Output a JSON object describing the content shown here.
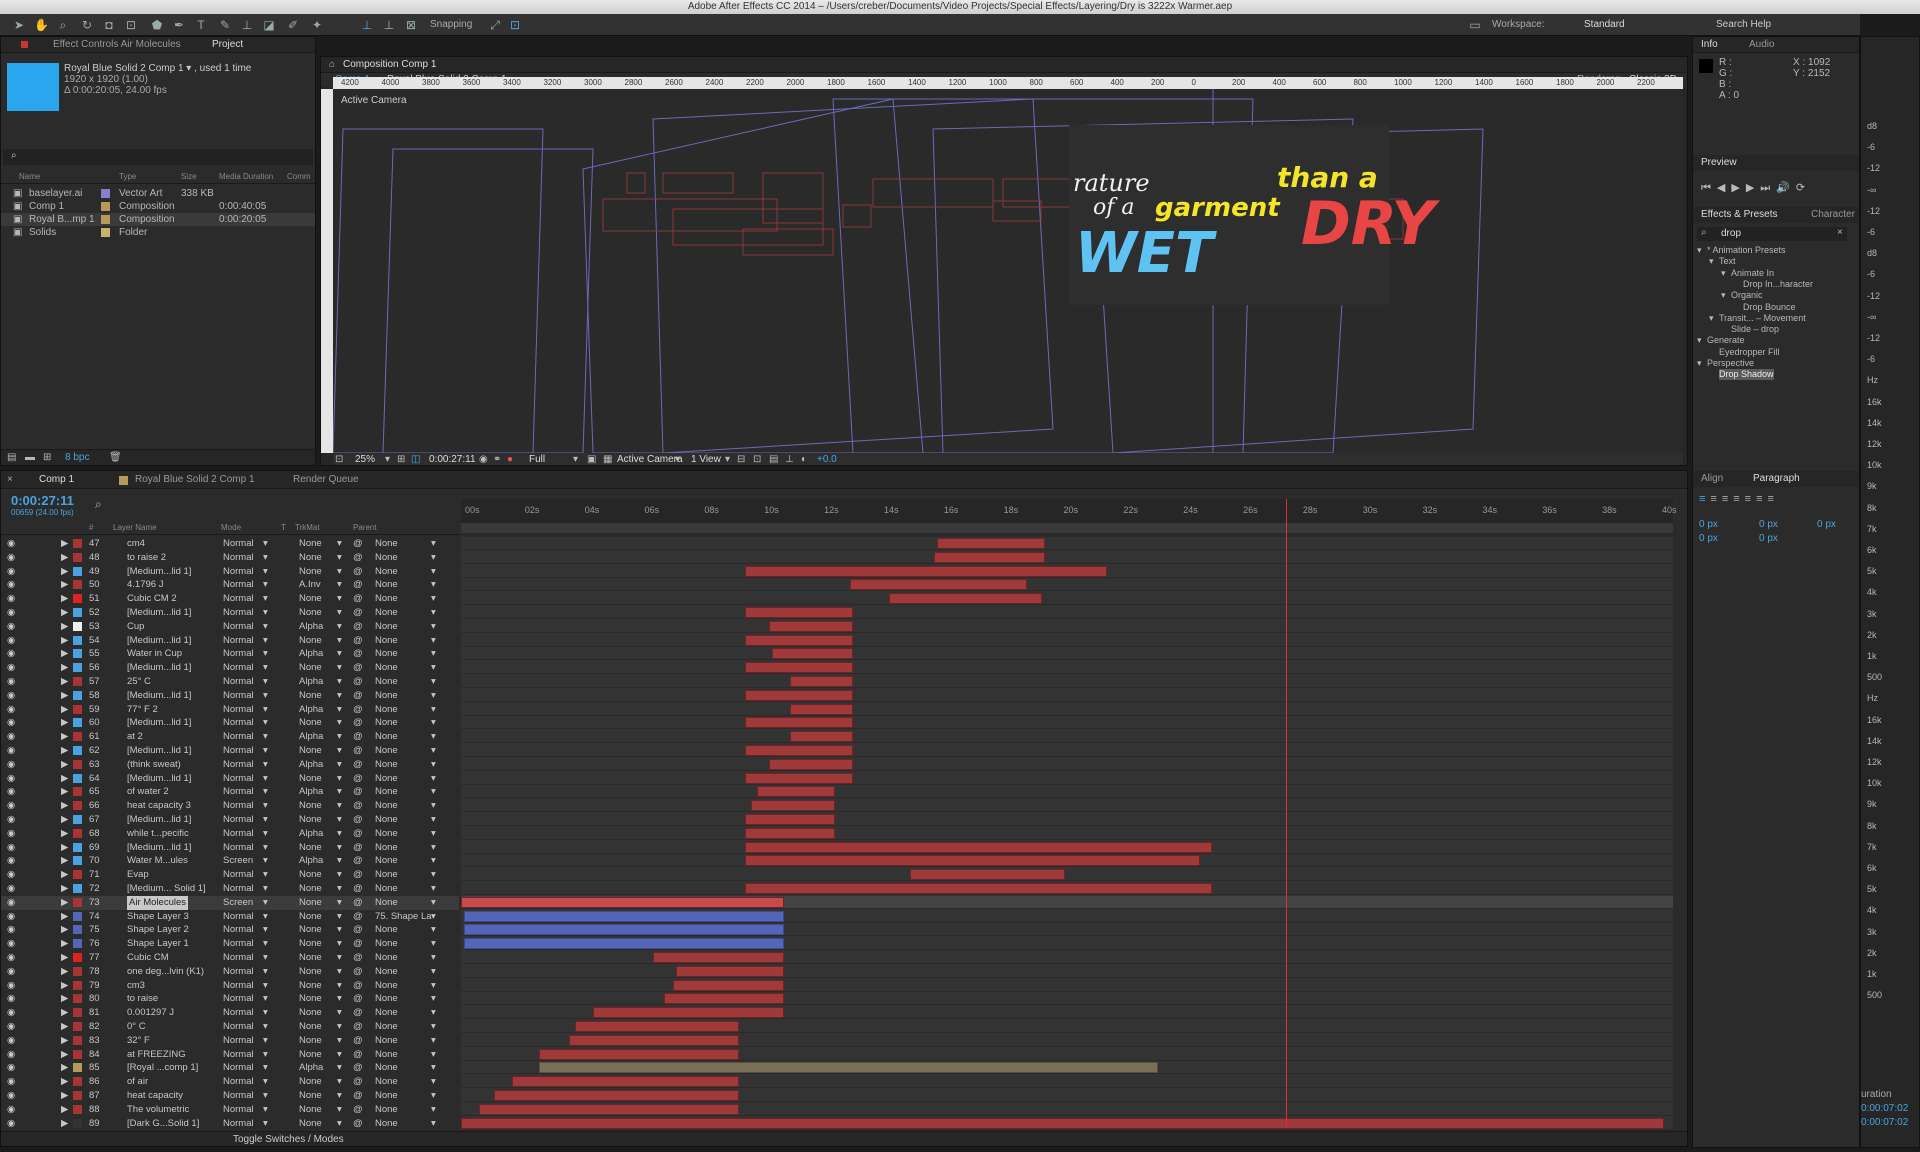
{
  "app": {
    "title": "Adobe After Effects CC 2014 – /Users/creber/Documents/Video Projects/Special Effects/Layering/Dry is 3222x Warmer.aep",
    "snapping": "Snapping",
    "workspace_label": "Workspace:",
    "workspace_value": "Standard",
    "search_help": "Search Help"
  },
  "project": {
    "tabs": [
      "Effect Controls Air Molecules",
      "Project"
    ],
    "selected_name": "Royal Blue Solid 2 Comp 1 ▾ , used 1 time",
    "dims": "1920 x 1920 (1.00)",
    "duration": "Δ 0:00:20:05, 24.00 fps",
    "columns": [
      "Name",
      "Type",
      "Size",
      "Media Duration",
      "Comm"
    ],
    "items": [
      {
        "name": "baselayer.ai",
        "type": "Vector Art",
        "size": "338 KB",
        "dur": "",
        "color": "#8b7fc7"
      },
      {
        "name": "Comp 1",
        "type": "Composition",
        "size": "",
        "dur": "0:00:40:05",
        "color": "#b59a5a"
      },
      {
        "name": "Royal B...mp 1",
        "type": "Composition",
        "size": "",
        "dur": "0:00:20:05",
        "color": "#b59a5a"
      },
      {
        "name": "Solids",
        "type": "Folder",
        "size": "",
        "dur": "",
        "color": "#c9b26b"
      }
    ],
    "bpc": "8 bpc"
  },
  "viewer": {
    "tab": "Composition Comp 1",
    "breadcrumb": [
      "Comp 1",
      "Royal Blue Solid 2 Comp 1"
    ],
    "renderer_label": "Renderer:",
    "renderer": "Classic 3D",
    "active_camera": "Active Camera",
    "ruler": [
      "4200",
      "4000",
      "3800",
      "3600",
      "3400",
      "3200",
      "3000",
      "2800",
      "2600",
      "2400",
      "2200",
      "2000",
      "1800",
      "1600",
      "1400",
      "1200",
      "1000",
      "800",
      "600",
      "400",
      "200",
      "0",
      "200",
      "400",
      "600",
      "800",
      "1000",
      "1200",
      "1400",
      "1600",
      "1800",
      "2000",
      "2200"
    ],
    "zoom": "25%",
    "timecode": "0:00:27:11",
    "resolution": "Full",
    "camera": "Active Camera",
    "views": "1 View",
    "exposure": "+0.0",
    "art": {
      "line1": "rature",
      "line2a": "of a",
      "line2b": "garment",
      "line3": "WET",
      "than": "than a",
      "dry": "DRY"
    }
  },
  "timeline": {
    "tabs": [
      "Comp 1",
      "Royal Blue Solid 2 Comp 1",
      "Render Queue"
    ],
    "timecode": "0:00:27:11",
    "frames": "00659 (24.00 fps)",
    "columns": [
      "#",
      "Layer Name",
      "Mode",
      "T",
      "TrkMat",
      "Parent"
    ],
    "ticks": [
      "00s",
      "02s",
      "04s",
      "06s",
      "08s",
      "10s",
      "12s",
      "14s",
      "16s",
      "18s",
      "20s",
      "22s",
      "24s",
      "26s",
      "28s",
      "30s",
      "32s",
      "34s",
      "36s",
      "38s",
      "40s"
    ],
    "toggle": "Toggle Switches / Modes",
    "layers": [
      {
        "n": "47",
        "name": "cm4",
        "mode": "Normal",
        "trk": "None",
        "parent": "None",
        "c": "#a33",
        "s": 15.9,
        "e": 19.5
      },
      {
        "n": "48",
        "name": "to raise 2",
        "mode": "Normal",
        "trk": "None",
        "parent": "None",
        "c": "#a33",
        "s": 15.8,
        "e": 19.5
      },
      {
        "n": "49",
        "name": "[Medium...lid 1]",
        "mode": "Normal",
        "trk": "None",
        "parent": "None",
        "c": "#4aa3e0",
        "s": 9.5,
        "e": 21.6
      },
      {
        "n": "50",
        "name": "4.1796 J",
        "mode": "Normal",
        "trk": "A.Inv",
        "parent": "None",
        "c": "#a33",
        "s": 13.0,
        "e": 18.9
      },
      {
        "n": "51",
        "name": "Cubic CM 2",
        "mode": "Normal",
        "trk": "None",
        "parent": "None",
        "c": "#d22",
        "s": 14.3,
        "e": 19.4
      },
      {
        "n": "52",
        "name": "[Medium...lid 1]",
        "mode": "Normal",
        "trk": "None",
        "parent": "None",
        "c": "#4aa3e0",
        "s": 9.5,
        "e": 13.1
      },
      {
        "n": "53",
        "name": "Cup",
        "mode": "Normal",
        "trk": "Alpha",
        "parent": "None",
        "c": "#eee",
        "s": 10.3,
        "e": 13.1
      },
      {
        "n": "54",
        "name": "[Medium...lid 1]",
        "mode": "Normal",
        "trk": "None",
        "parent": "None",
        "c": "#4aa3e0",
        "s": 9.5,
        "e": 13.1
      },
      {
        "n": "55",
        "name": "Water in Cup",
        "mode": "Normal",
        "trk": "Alpha",
        "parent": "None",
        "c": "#4aa3e0",
        "s": 10.4,
        "e": 13.1
      },
      {
        "n": "56",
        "name": "[Medium...lid 1]",
        "mode": "Normal",
        "trk": "None",
        "parent": "None",
        "c": "#4aa3e0",
        "s": 9.5,
        "e": 13.1
      },
      {
        "n": "57",
        "name": "25° C",
        "mode": "Normal",
        "trk": "Alpha",
        "parent": "None",
        "c": "#a33",
        "s": 11.0,
        "e": 13.1
      },
      {
        "n": "58",
        "name": "[Medium...lid 1]",
        "mode": "Normal",
        "trk": "None",
        "parent": "None",
        "c": "#4aa3e0",
        "s": 9.5,
        "e": 13.1
      },
      {
        "n": "59",
        "name": "77° F 2",
        "mode": "Normal",
        "trk": "Alpha",
        "parent": "None",
        "c": "#a33",
        "s": 11.0,
        "e": 13.1
      },
      {
        "n": "60",
        "name": "[Medium...lid 1]",
        "mode": "Normal",
        "trk": "None",
        "parent": "None",
        "c": "#4aa3e0",
        "s": 9.5,
        "e": 13.1
      },
      {
        "n": "61",
        "name": "at 2",
        "mode": "Normal",
        "trk": "Alpha",
        "parent": "None",
        "c": "#a33",
        "s": 11.0,
        "e": 13.1
      },
      {
        "n": "62",
        "name": "[Medium...lid 1]",
        "mode": "Normal",
        "trk": "None",
        "parent": "None",
        "c": "#4aa3e0",
        "s": 9.5,
        "e": 13.1
      },
      {
        "n": "63",
        "name": "(think sweat)",
        "mode": "Normal",
        "trk": "Alpha",
        "parent": "None",
        "c": "#a33",
        "s": 10.3,
        "e": 13.1
      },
      {
        "n": "64",
        "name": "[Medium...lid 1]",
        "mode": "Normal",
        "trk": "None",
        "parent": "None",
        "c": "#4aa3e0",
        "s": 9.5,
        "e": 13.1
      },
      {
        "n": "65",
        "name": "of water 2",
        "mode": "Normal",
        "trk": "Alpha",
        "parent": "None",
        "c": "#a33",
        "s": 9.9,
        "e": 12.5
      },
      {
        "n": "66",
        "name": "heat capacity 3",
        "mode": "Normal",
        "trk": "None",
        "parent": "None",
        "c": "#a33",
        "s": 9.7,
        "e": 12.5
      },
      {
        "n": "67",
        "name": "[Medium...lid 1]",
        "mode": "Normal",
        "trk": "None",
        "parent": "None",
        "c": "#4aa3e0",
        "s": 9.5,
        "e": 12.5
      },
      {
        "n": "68",
        "name": "while t...pecific",
        "mode": "Normal",
        "trk": "Alpha",
        "parent": "None",
        "c": "#a33",
        "s": 9.5,
        "e": 12.5
      },
      {
        "n": "69",
        "name": "[Medium...lid 1]",
        "mode": "Normal",
        "trk": "None",
        "parent": "None",
        "c": "#4aa3e0",
        "s": 9.5,
        "e": 25.1
      },
      {
        "n": "70",
        "name": "Water M...ules",
        "mode": "Screen",
        "trk": "Alpha",
        "parent": "None",
        "c": "#4aa3e0",
        "s": 9.5,
        "e": 24.7
      },
      {
        "n": "71",
        "name": "Evap",
        "mode": "Normal",
        "trk": "None",
        "parent": "None",
        "c": "#a33",
        "s": 15.0,
        "e": 20.2
      },
      {
        "n": "72",
        "name": "[Medium... Solid 1]",
        "mode": "Normal",
        "trk": "None",
        "parent": "None",
        "c": "#4aa3e0",
        "s": 9.5,
        "e": 25.1
      },
      {
        "n": "73",
        "name": "Air Molecules",
        "mode": "Screen",
        "trk": "None",
        "parent": "None",
        "c": "#a33",
        "s": 0,
        "e": 10.8,
        "sel": true
      },
      {
        "n": "74",
        "name": "Shape Layer 3",
        "mode": "Normal",
        "trk": "None",
        "parent": "75. Shape La",
        "c": "#5566b8",
        "s": 0.1,
        "e": 10.8,
        "blue": true
      },
      {
        "n": "75",
        "name": "Shape Layer 2",
        "mode": "Normal",
        "trk": "None",
        "parent": "None",
        "c": "#5566b8",
        "s": 0.1,
        "e": 10.8,
        "blue": true
      },
      {
        "n": "76",
        "name": "Shape Layer 1",
        "mode": "Normal",
        "trk": "None",
        "parent": "None",
        "c": "#5566b8",
        "s": 0.1,
        "e": 10.8,
        "blue": true
      },
      {
        "n": "77",
        "name": "Cubic CM",
        "mode": "Normal",
        "trk": "None",
        "parent": "None",
        "c": "#d22",
        "s": 6.4,
        "e": 10.8
      },
      {
        "n": "78",
        "name": "one deg...lvin (K1)",
        "mode": "Normal",
        "trk": "None",
        "parent": "None",
        "c": "#a33",
        "s": 7.2,
        "e": 10.8
      },
      {
        "n": "79",
        "name": "cm3",
        "mode": "Normal",
        "trk": "None",
        "parent": "None",
        "c": "#a33",
        "s": 7.1,
        "e": 10.8
      },
      {
        "n": "80",
        "name": "to raise",
        "mode": "Normal",
        "trk": "None",
        "parent": "None",
        "c": "#a33",
        "s": 6.8,
        "e": 10.8
      },
      {
        "n": "81",
        "name": "0.001297 J",
        "mode": "Normal",
        "trk": "None",
        "parent": "None",
        "c": "#a33",
        "s": 4.4,
        "e": 10.8
      },
      {
        "n": "82",
        "name": "0° C",
        "mode": "Normal",
        "trk": "None",
        "parent": "None",
        "c": "#a33",
        "s": 3.8,
        "e": 9.3
      },
      {
        "n": "83",
        "name": "32° F",
        "mode": "Normal",
        "trk": "None",
        "parent": "None",
        "c": "#a33",
        "s": 3.6,
        "e": 9.3
      },
      {
        "n": "84",
        "name": "at FREEZING",
        "mode": "Normal",
        "trk": "None",
        "parent": "None",
        "c": "#a33",
        "s": 2.6,
        "e": 9.3
      },
      {
        "n": "85",
        "name": "[Royal ...comp 1]",
        "mode": "Normal",
        "trk": "Alpha",
        "parent": "None",
        "c": "#b59a5a",
        "s": 2.6,
        "e": 23.3,
        "tan": true
      },
      {
        "n": "86",
        "name": "of air",
        "mode": "Normal",
        "trk": "None",
        "parent": "None",
        "c": "#a33",
        "s": 1.7,
        "e": 9.3
      },
      {
        "n": "87",
        "name": "heat capacity",
        "mode": "Normal",
        "trk": "None",
        "parent": "None",
        "c": "#a33",
        "s": 1.1,
        "e": 9.3
      },
      {
        "n": "88",
        "name": "The volumetric",
        "mode": "Normal",
        "trk": "None",
        "parent": "None",
        "c": "#a33",
        "s": 0.6,
        "e": 9.3
      },
      {
        "n": "89",
        "name": "[Dark G...Solid 1]",
        "mode": "Normal",
        "trk": "None",
        "parent": "None",
        "c": "#333",
        "s": 0,
        "e": 40.2
      }
    ]
  },
  "info": {
    "tabs": [
      "Info",
      "Audio"
    ],
    "r": "R :",
    "g": "G :",
    "b": "B :",
    "a": "A : 0",
    "x": "X : 1092",
    "y": "Y : 2152"
  },
  "preview": {
    "tab": "Preview"
  },
  "effects": {
    "tabs": [
      "Effects & Presets",
      "Character"
    ],
    "search": "drop",
    "tree": [
      {
        "t": "* Animation Presets",
        "d": 0
      },
      {
        "t": "Text",
        "d": 1
      },
      {
        "t": "Animate In",
        "d": 2
      },
      {
        "t": "Drop In...haracter",
        "d": 3
      },
      {
        "t": "Organic",
        "d": 2
      },
      {
        "t": "Drop Bounce",
        "d": 3
      },
      {
        "t": "Transit... – Movement",
        "d": 1
      },
      {
        "t": "Slide – drop",
        "d": 2
      },
      {
        "t": "Generate",
        "d": 0
      },
      {
        "t": "Eyedropper Fill",
        "d": 1
      },
      {
        "t": "Perspective",
        "d": 0
      },
      {
        "t": "Drop Shadow",
        "d": 1
      }
    ]
  },
  "paragraph": {
    "tabs": [
      "Align",
      "Paragraph"
    ],
    "vals": [
      "0 px",
      "0 px",
      "0 px",
      "0 px",
      "0 px"
    ]
  },
  "meter": {
    "labels": [
      "d8",
      "-6",
      "-12",
      "-∞",
      "-12",
      "-6",
      "d8",
      "-6",
      "-12",
      "-∞",
      "-12",
      "-6",
      "Hz",
      "16k",
      "14k",
      "12k",
      "10k",
      "9k",
      "8k",
      "7k",
      "6k",
      "5k",
      "4k",
      "3k",
      "2k",
      "1k",
      "500",
      "Hz",
      "16k",
      "14k",
      "12k",
      "10k",
      "9k",
      "8k",
      "7k",
      "6k",
      "5k",
      "4k",
      "3k",
      "2k",
      "1k",
      "500"
    ],
    "duration": "uration",
    "d1": "0:00:07:02",
    "d2": "0:00:07:02"
  }
}
